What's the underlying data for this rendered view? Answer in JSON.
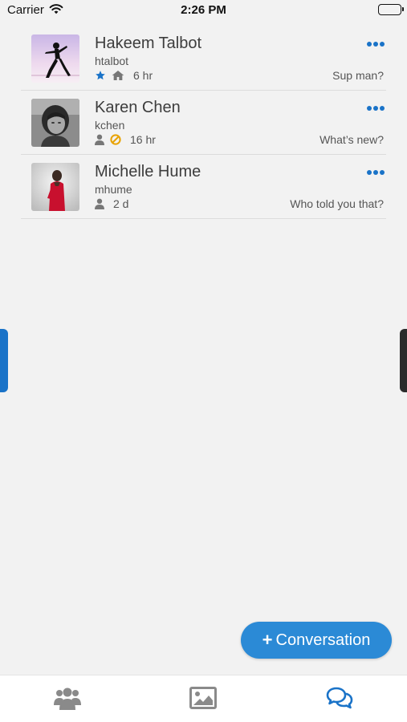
{
  "status_bar": {
    "carrier": "Carrier",
    "time": "2:26 PM"
  },
  "colors": {
    "accent": "#1a73c8",
    "fab": "#2b8ad6",
    "background": "#f2f2f2",
    "warning": "#e8a200",
    "favorite": "#1a73c8"
  },
  "conversations": [
    {
      "name": "Hakeem Talbot",
      "username": "htalbot",
      "status_icons": [
        "star-icon",
        "home-icon"
      ],
      "age": "6 hr",
      "preview": "Sup man?"
    },
    {
      "name": "Karen Chen",
      "username": "kchen",
      "status_icons": [
        "person-icon",
        "blocked-icon"
      ],
      "age": "16 hr",
      "preview": "What’s new?"
    },
    {
      "name": "Michelle Hume",
      "username": "mhume",
      "status_icons": [
        "person-icon"
      ],
      "age": "2 d",
      "preview": "Who told you that?"
    }
  ],
  "fab": {
    "label": "Conversation",
    "icon": "plus-icon"
  },
  "tabs": [
    {
      "icon": "people-icon",
      "active": false
    },
    {
      "icon": "image-icon",
      "active": false
    },
    {
      "icon": "chat-bubbles-icon",
      "active": true
    }
  ]
}
